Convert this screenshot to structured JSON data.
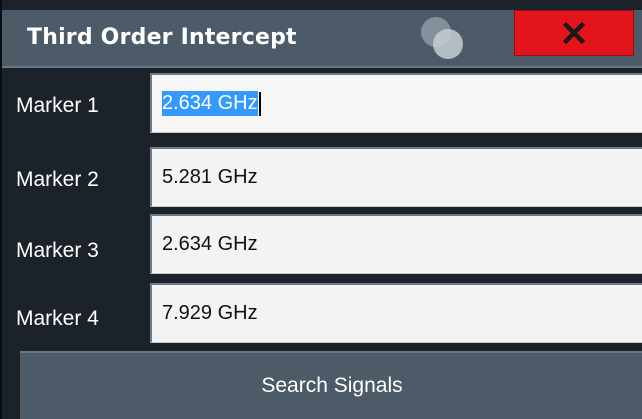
{
  "dialog": {
    "title": "Third Order Intercept",
    "close_icon": "close-x-icon",
    "colors": {
      "close": "#e3141c",
      "selection": "#3399ff",
      "header": "#4d5a68"
    }
  },
  "markers": [
    {
      "label": "Marker 1",
      "value": "2.634 GHz",
      "focused": true
    },
    {
      "label": "Marker 2",
      "value": "5.281 GHz"
    },
    {
      "label": "Marker 3",
      "value": "2.634 GHz"
    },
    {
      "label": "Marker 4",
      "value": "7.929 GHz"
    }
  ],
  "search_button": {
    "label": "Search Signals"
  }
}
